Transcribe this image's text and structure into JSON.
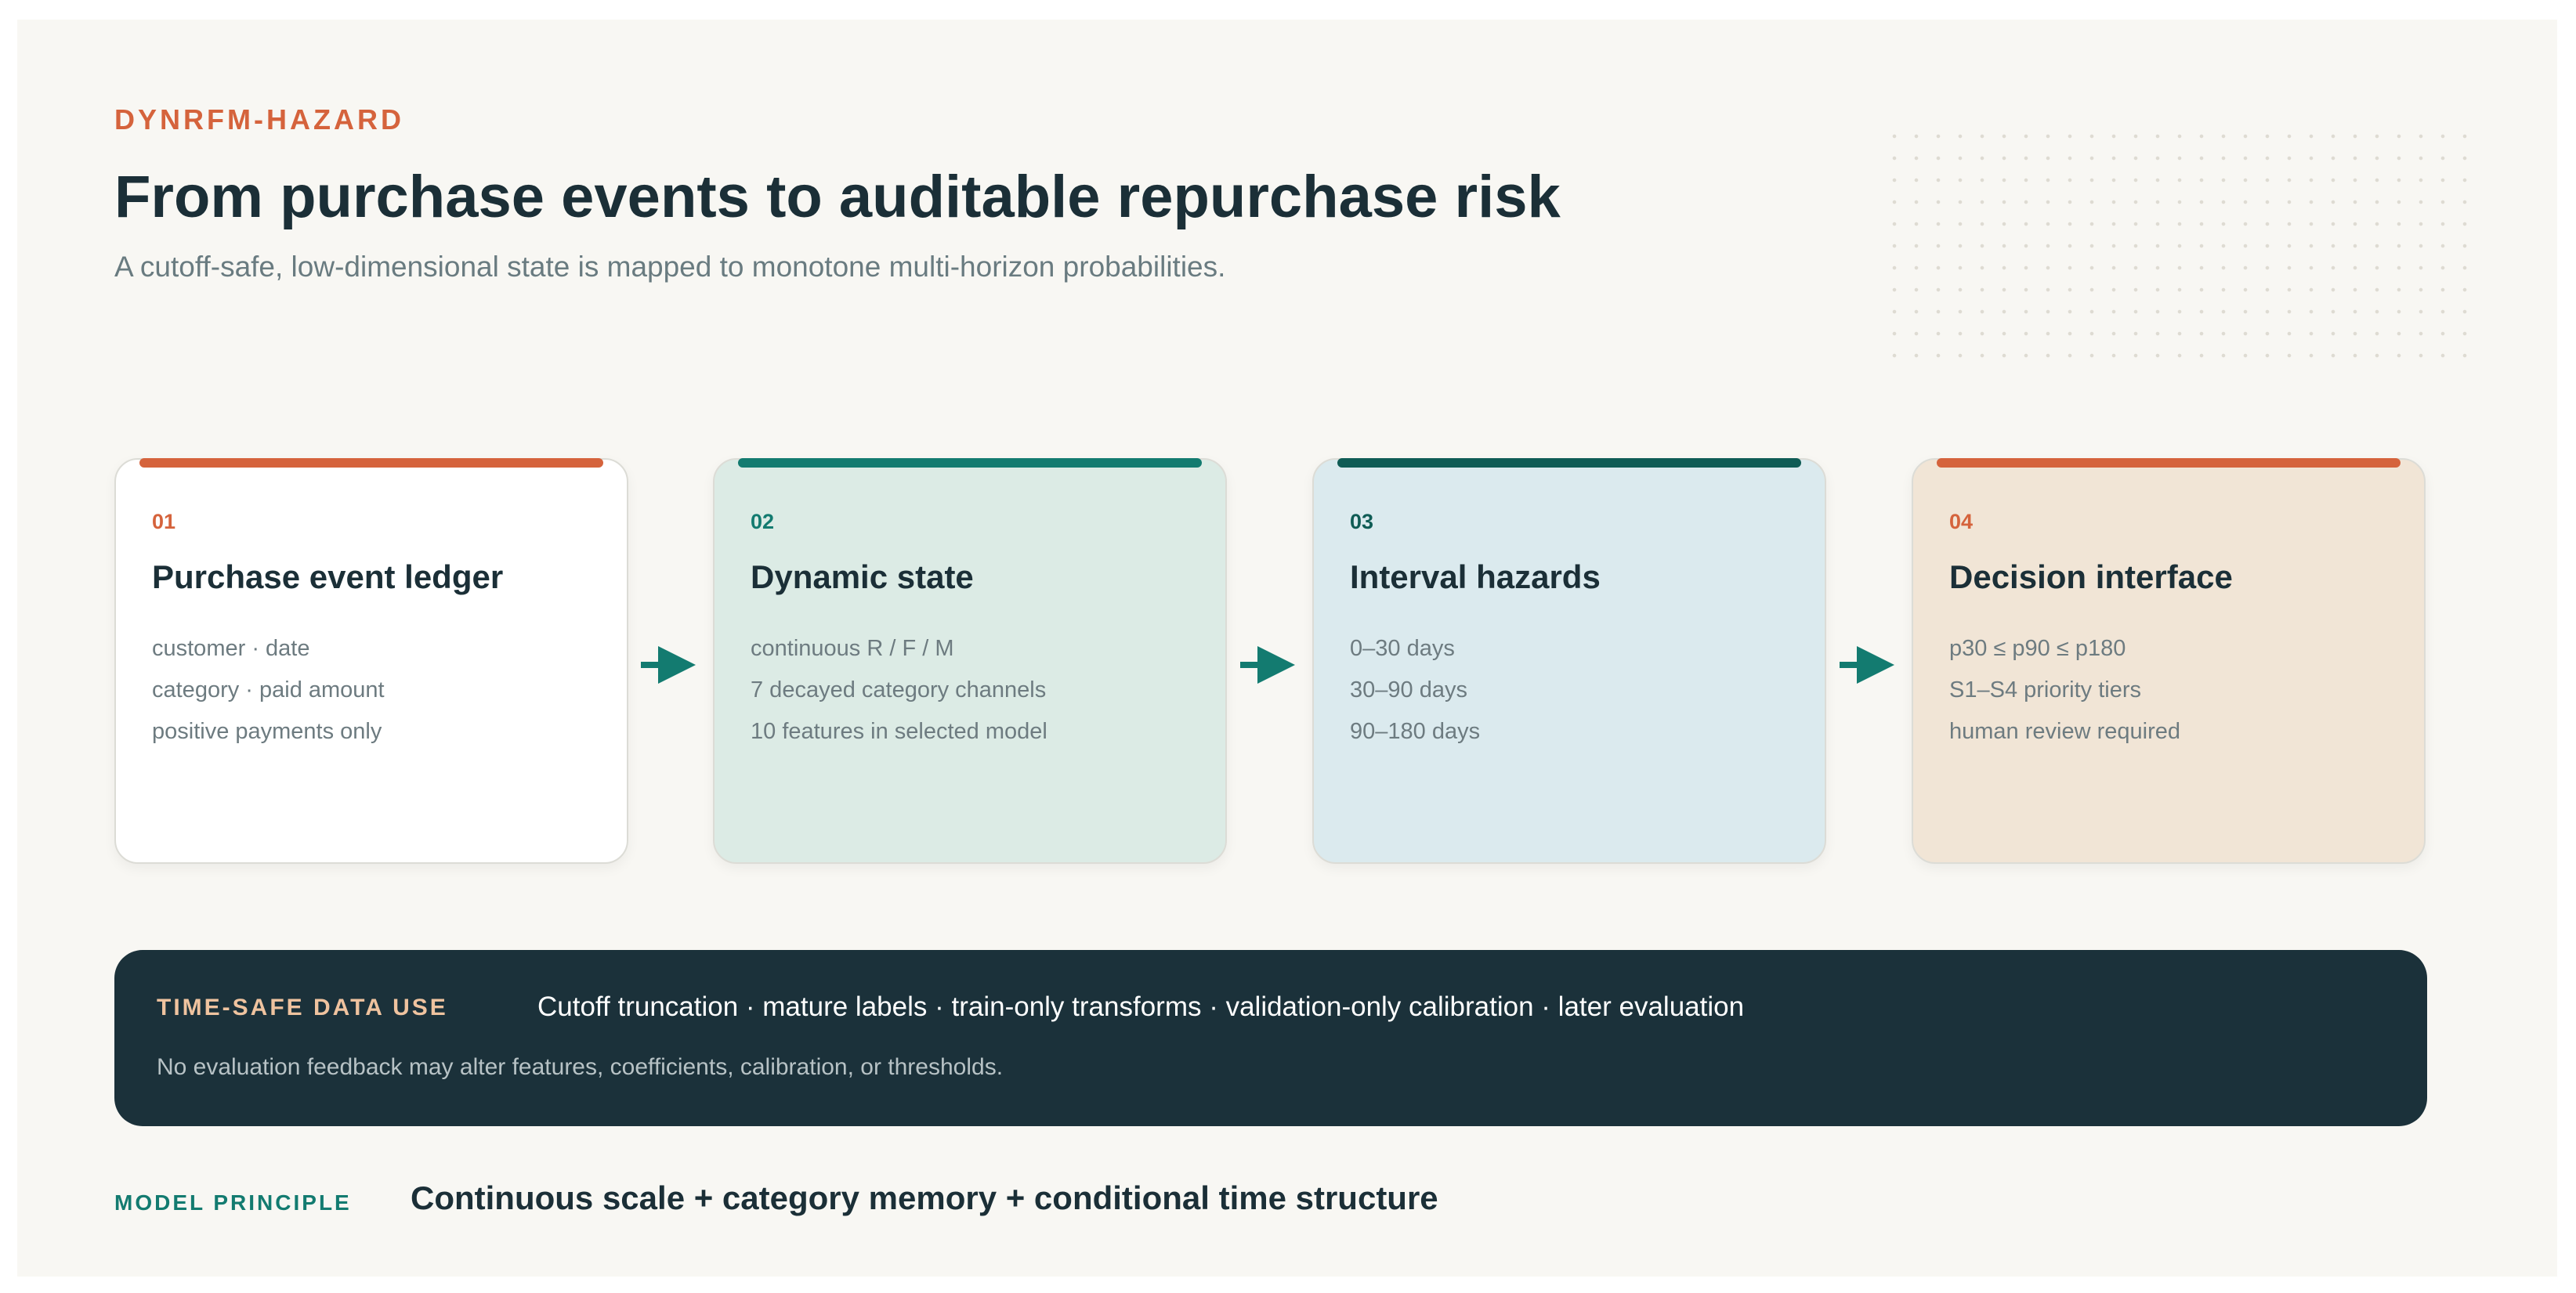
{
  "header": {
    "eyebrow": "DYNRFM-HAZARD",
    "title": "From purchase events to auditable repurchase risk",
    "subtitle": "A cutoff-safe, low-dimensional state is mapped to monotone multi-horizon probabilities."
  },
  "steps": [
    {
      "number": "01",
      "title": "Purchase event ledger",
      "lines": [
        "customer · date",
        "category · paid amount",
        "positive payments only"
      ],
      "accent": "#d5633c",
      "background": "#ffffff"
    },
    {
      "number": "02",
      "title": "Dynamic state",
      "lines": [
        "continuous R / F / M",
        "7 decayed category channels",
        "10 features in selected model"
      ],
      "accent": "#137b70",
      "background": "#dcebe5"
    },
    {
      "number": "03",
      "title": "Interval hazards",
      "lines": [
        "0–30 days",
        "30–90 days",
        "90–180 days"
      ],
      "accent": "#0f5c55",
      "background": "#dbeaee"
    },
    {
      "number": "04",
      "title": "Decision interface",
      "lines": [
        "p30 ≤ p90 ≤ p180",
        "S1–S4 priority tiers",
        "human review required"
      ],
      "accent": "#d5633c",
      "background": "#f1e5d6"
    }
  ],
  "arrow_color": "#137b70",
  "band": {
    "label": "TIME-SAFE DATA USE",
    "main": "Cutoff truncation · mature labels · train-only transforms · validation-only calibration · later evaluation",
    "note": "No evaluation feedback may alter features, coefficients, calibration, or thresholds."
  },
  "principle": {
    "label": "MODEL PRINCIPLE",
    "text": "Continuous scale + category memory + conditional time structure"
  }
}
